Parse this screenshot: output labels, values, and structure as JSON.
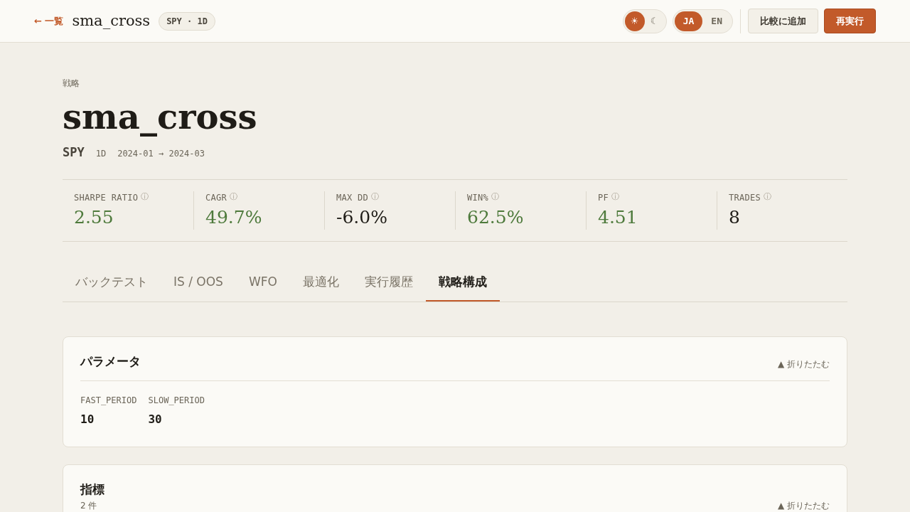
{
  "header": {
    "back_link": "← 一覧",
    "title": "sma_cross",
    "badge": "SPY · 1D",
    "theme_toggle": [
      {
        "label": "☀",
        "selected": true
      },
      {
        "label": "☾",
        "selected": false
      }
    ],
    "language_toggle": [
      {
        "label": "JA",
        "selected": true
      },
      {
        "label": "EN",
        "selected": false
      }
    ],
    "buttons": [
      {
        "label": "比較に追加",
        "kind": "secondary"
      },
      {
        "label": "再実行",
        "kind": "primary"
      }
    ]
  },
  "page": {
    "eyebrow": "戦略",
    "title": "sma_cross",
    "symbol": "SPY",
    "timeframe": "1D",
    "range": "2024-01 → 2024-03"
  },
  "metrics": [
    {
      "label": "SHARPE RATIO",
      "info": "ⓘ",
      "value": "2.55",
      "color": "#4e7a3c"
    },
    {
      "label": "CAGR",
      "info": "ⓘ",
      "value": "49.7%",
      "color": "#4e7a3c"
    },
    {
      "label": "MAX DD",
      "info": "ⓘ",
      "value": "-6.0%",
      "color": "#1f1c17"
    },
    {
      "label": "WIN%",
      "info": "ⓘ",
      "value": "62.5%",
      "color": "#4e7a3c"
    },
    {
      "label": "PF",
      "info": "ⓘ",
      "value": "4.51",
      "color": "#4e7a3c"
    },
    {
      "label": "TRADES",
      "info": "ⓘ",
      "value": "8",
      "color": "#1f1c17"
    }
  ],
  "tabs": [
    {
      "label": "バックテスト",
      "selected": false
    },
    {
      "label": "IS / OOS",
      "selected": false
    },
    {
      "label": "WFO",
      "selected": false
    },
    {
      "label": "最適化",
      "selected": false
    },
    {
      "label": "実行履歴",
      "selected": false
    },
    {
      "label": "戦略構成",
      "selected": true
    }
  ],
  "sections": [
    {
      "title": "パラメータ",
      "collapse": "▲ 折りたたむ",
      "params": [
        {
          "name": "FAST_PERIOD",
          "value": "10"
        },
        {
          "name": "SLOW_PERIOD",
          "value": "30"
        }
      ]
    },
    {
      "title": "指標",
      "count": "2 件",
      "collapse": "▲ 折りたたむ"
    }
  ]
}
